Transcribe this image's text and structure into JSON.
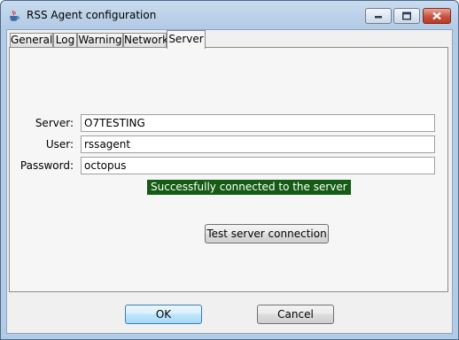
{
  "window": {
    "title": "RSS Agent configuration",
    "icon": "java-cup-icon"
  },
  "tabs": [
    {
      "label": "General",
      "active": false
    },
    {
      "label": "Log",
      "active": false
    },
    {
      "label": "Warning",
      "active": false
    },
    {
      "label": "Network",
      "active": false
    },
    {
      "label": "Server",
      "active": true
    }
  ],
  "server_tab": {
    "server_label": "Server:",
    "server_value": "O7TESTING",
    "user_label": "User:",
    "user_value": "rssagent",
    "password_label": "Password:",
    "password_value": "octopus",
    "status_text": "Successfully connected to the server",
    "status_color": "#145c14",
    "test_button": "Test server connection"
  },
  "footer": {
    "ok_label": "OK",
    "cancel_label": "Cancel"
  }
}
